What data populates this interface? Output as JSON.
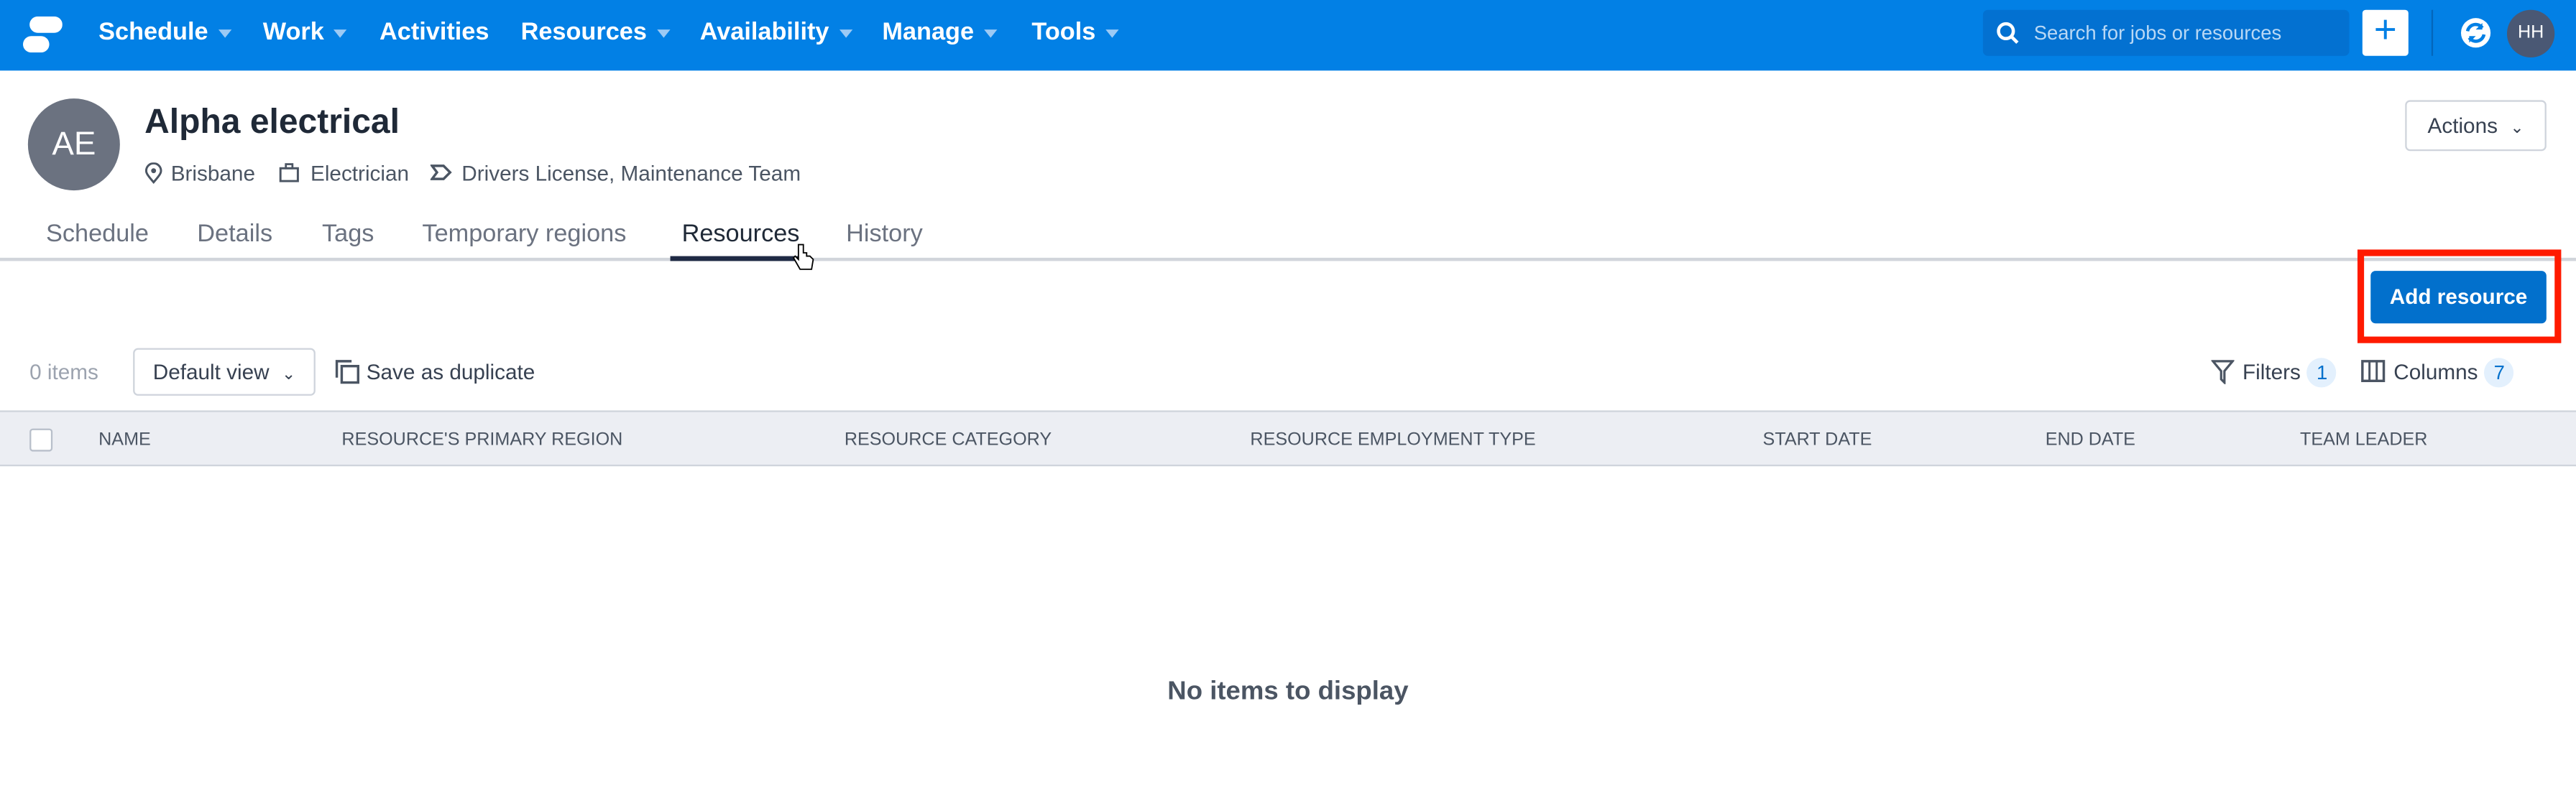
{
  "nav": {
    "items": [
      {
        "label": "Schedule",
        "dropdown": true
      },
      {
        "label": "Work",
        "dropdown": true
      },
      {
        "label": "Activities",
        "dropdown": false
      },
      {
        "label": "Resources",
        "dropdown": true
      },
      {
        "label": "Availability",
        "dropdown": true
      },
      {
        "label": "Manage",
        "dropdown": true
      },
      {
        "label": "Tools",
        "dropdown": true
      }
    ],
    "search_placeholder": "Search for jobs or resources",
    "add_label": "+",
    "user_initials": "HH",
    "color": "#0280e5"
  },
  "profile": {
    "initials": "AE",
    "name": "Alpha electrical",
    "location": "Brisbane",
    "role": "Electrician",
    "tags": "Drivers License, Maintenance Team",
    "actions_label": "Actions"
  },
  "tabs": [
    {
      "label": "Schedule"
    },
    {
      "label": "Details"
    },
    {
      "label": "Tags"
    },
    {
      "label": "Temporary regions"
    },
    {
      "label": "Resources",
      "active": true
    },
    {
      "label": "History"
    }
  ],
  "toolbar": {
    "add_resource": "Add resource",
    "item_count": "0 items",
    "view": "Default view",
    "save_duplicate": "Save as duplicate",
    "filters_label": "Filters",
    "filters_count": "1",
    "columns_label": "Columns",
    "columns_count": "7"
  },
  "table": {
    "columns": [
      "Name",
      "Resource's primary region",
      "Resource category",
      "Resource employment type",
      "Start date",
      "End date",
      "Team leader"
    ],
    "empty_text": "No items to display"
  }
}
